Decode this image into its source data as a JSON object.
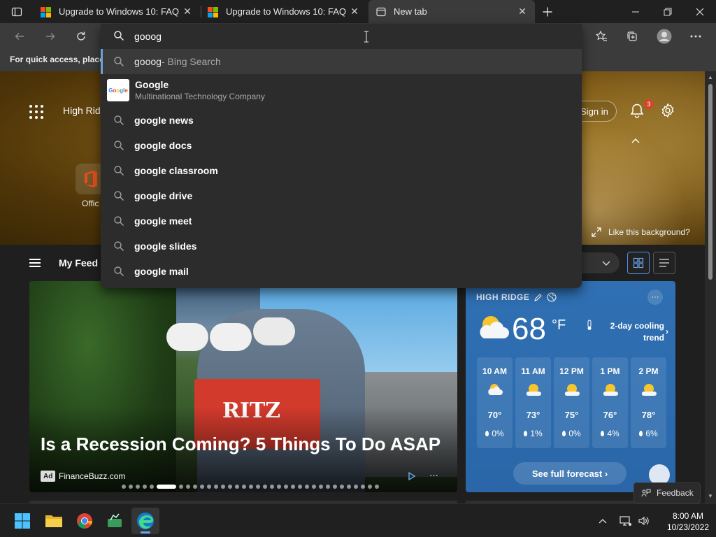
{
  "colors": {
    "accent": "#6a9fd8",
    "badge": "#d64527",
    "weather_card": "#2f6fb2"
  },
  "tabs": [
    {
      "title": "Upgrade to Windows 10: FAQ",
      "icon": "windows-logo-icon"
    },
    {
      "title": "Upgrade to Windows 10: FAQ",
      "icon": "windows-logo-icon"
    },
    {
      "title": "New tab",
      "icon": "new-tab-icon",
      "active": true
    }
  ],
  "favorites_bar": {
    "text": "For quick access, place y"
  },
  "omnibox": {
    "value": "gooog",
    "suggestions": [
      {
        "bold": "gooog",
        "suffix": " - Bing Search",
        "selected": true
      },
      {
        "entity_title": "Google",
        "entity_subtitle": "Multinational Technology Company",
        "logo": "Google"
      },
      {
        "bold": "google news"
      },
      {
        "bold": "google docs"
      },
      {
        "bold": "google classroom"
      },
      {
        "bold": "google drive"
      },
      {
        "bold": "google meet"
      },
      {
        "bold": "google slides"
      },
      {
        "bold": "google mail"
      }
    ]
  },
  "hero": {
    "location": "High Rid",
    "office_label": "Offic",
    "signin": "Sign in",
    "notification_count": "3",
    "like_background": "Like this background?"
  },
  "feed": {
    "title": "My Feed"
  },
  "article": {
    "headline": "Is a Recession Coming? 5 Things To Do ASAP",
    "ad_label": "Ad",
    "source": "FinanceBuzz.com",
    "more": "···",
    "box_text": "RITZ"
  },
  "weather": {
    "location": "HIGH RIDGE",
    "temp": "68",
    "unit": "°F",
    "trend": "2-day cooling trend",
    "more": "···",
    "hours": [
      {
        "time": "10 AM",
        "temp": "70°",
        "precip": "0%"
      },
      {
        "time": "11 AM",
        "temp": "73°",
        "precip": "1%"
      },
      {
        "time": "12 PM",
        "temp": "75°",
        "precip": "0%"
      },
      {
        "time": "1 PM",
        "temp": "76°",
        "precip": "4%"
      },
      {
        "time": "2 PM",
        "temp": "78°",
        "precip": "6%"
      }
    ],
    "forecast_button": "See full forecast ›"
  },
  "feedback": {
    "label": "Feedback"
  },
  "taskbar": {
    "time": "8:00 AM",
    "date": "10/23/2022"
  }
}
